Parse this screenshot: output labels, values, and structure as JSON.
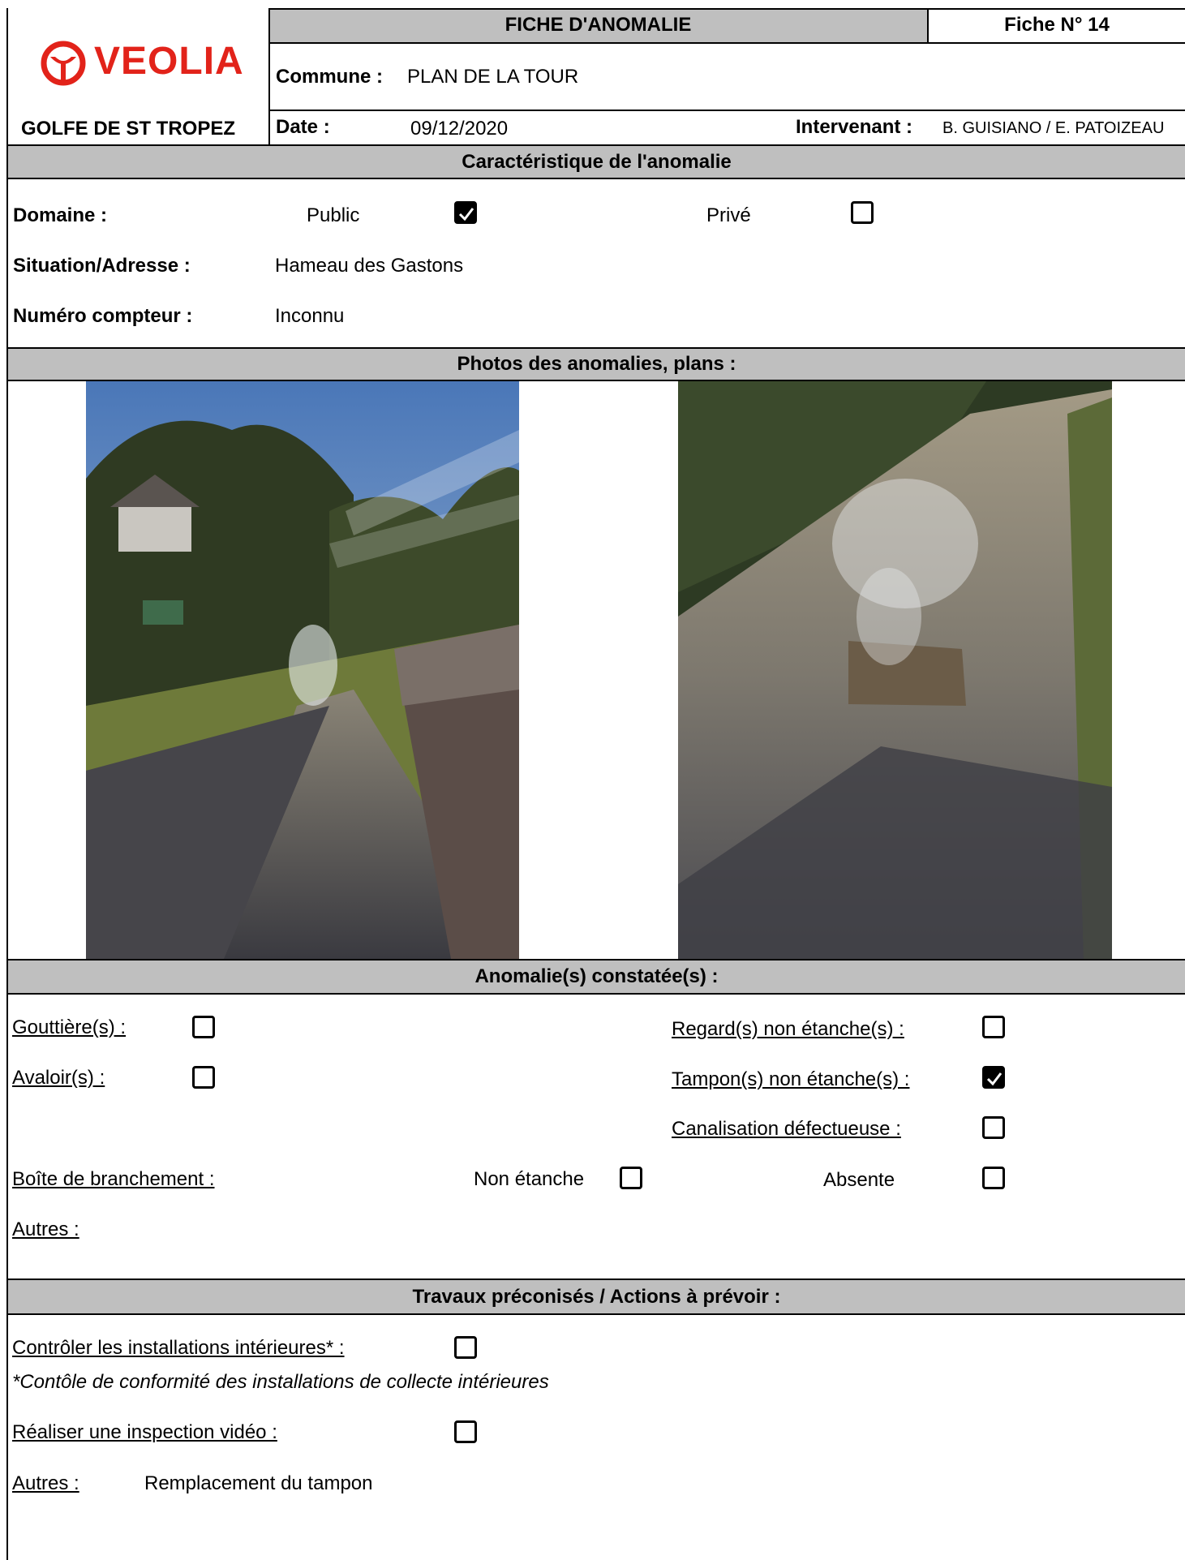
{
  "header": {
    "logo_text": "VEOLIA",
    "region": "GOLFE DE ST TROPEZ",
    "title": "FICHE D'ANOMALIE",
    "fiche_label": "Fiche N° 14",
    "commune_label": "Commune :",
    "commune_value": "PLAN DE LA TOUR",
    "date_label": "Date :",
    "date_value": "09/12/2020",
    "intervenant_label": "Intervenant :",
    "intervenant_value": "B. GUISIANO / E. PATOIZEAU"
  },
  "caracteristique": {
    "title": "Caractéristique de l'anomalie",
    "domaine_label": "Domaine :",
    "public_label": "Public",
    "public_checked": true,
    "prive_label": "Privé",
    "prive_checked": false,
    "situation_label": "Situation/Adresse :",
    "situation_value": "Hameau des Gastons",
    "compteur_label": "Numéro compteur :",
    "compteur_value": "Inconnu"
  },
  "photos": {
    "title": "Photos des anomalies, plans :"
  },
  "anomalies": {
    "title": "Anomalie(s) constatée(s) :",
    "gouttieres_label": "Gouttière(s) :",
    "gouttieres_checked": false,
    "avaloirs_label": "Avaloir(s) :",
    "avaloirs_checked": false,
    "regards_label": "Regard(s) non étanche(s) :",
    "regards_checked": false,
    "tampons_label": "Tampon(s) non étanche(s) :",
    "tampons_checked": true,
    "canalisation_label": "Canalisation défectueuse :",
    "canalisation_checked": false,
    "boite_label": "Boîte de branchement :",
    "non_etanche_label": "Non étanche",
    "non_etanche_checked": false,
    "absente_label": "Absente",
    "absente_checked": false,
    "autres_label": "Autres :"
  },
  "travaux": {
    "title": "Travaux préconisés / Actions à prévoir :",
    "controler_label": "Contrôler les installations intérieures* :",
    "controler_checked": false,
    "note": "*Contôle de conformité des installations de collecte intérieures",
    "inspection_label": "Réaliser une inspection vidéo :",
    "inspection_checked": false,
    "autres_label": "Autres :",
    "autres_value": "Remplacement du tampon"
  },
  "colors": {
    "brand": "#e2231a",
    "header_band": "#bfbfbf"
  }
}
